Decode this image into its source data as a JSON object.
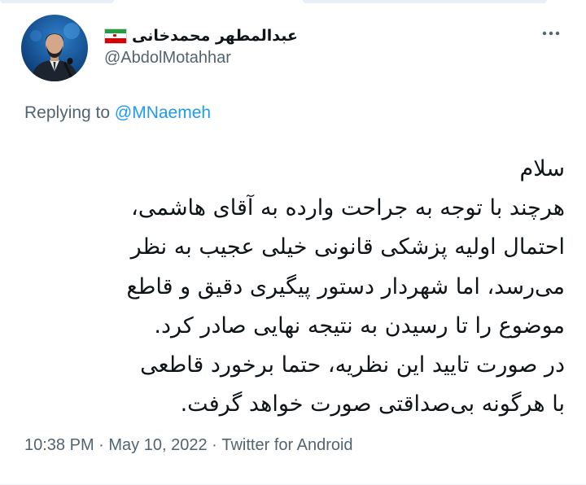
{
  "tweet": {
    "display_name": "عبدالمطهر محمدخانی",
    "handle": "@AbdolMotahhar",
    "replying_prefix": "Replying to ",
    "replying_to": "@MNaemeh",
    "text_lines": [
      "سلام",
      "هرچند با توجه به جراحت وارده به آقای هاشمی،",
      "احتمال اولیه پزشکی قانونی خیلی عجیب به نظر",
      "می‌رسد، اما شهردار دستور پیگیری دقیق و قاطع",
      "موضوع را تا رسیدن به نتیجه نهایی صادر کرد.",
      "در صورت تایید این نظریه، حتما برخورد قاطعی",
      "با هرگونه بی‌صداقتی صورت خواهد گرفت."
    ],
    "time": "10:38 PM",
    "separator_1": " · ",
    "date": "May 10, 2022",
    "separator_2": " · ",
    "source": "Twitter for Android"
  },
  "icons": {
    "flag": "iran-flag-icon",
    "more": "more-options-icon",
    "avatar": "profile-avatar"
  },
  "colors": {
    "text": "#0f1419",
    "secondary": "#536471",
    "link": "#1d9bf0"
  }
}
